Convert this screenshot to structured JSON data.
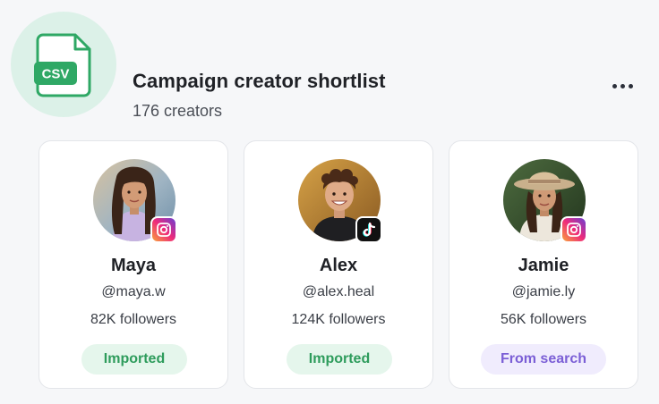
{
  "header": {
    "file_badge": "CSV",
    "title": "Campaign creator shortlist",
    "count": "176 creators",
    "menu_icon": "more-horizontal-icon"
  },
  "colors": {
    "accent_green": "#2fa865",
    "imported_bg": "#e5f6ec",
    "imported_text": "#2e9c5c",
    "search_bg": "#f0ecfd",
    "search_text": "#7b5fd6"
  },
  "creators": [
    {
      "name": "Maya",
      "handle": "@maya.w",
      "followers": "82K followers",
      "platform_icon": "instagram-icon",
      "source": "Imported"
    },
    {
      "name": "Alex",
      "handle": "@alex.heal",
      "followers": "124K followers",
      "platform_icon": "tiktok-icon",
      "source": "Imported"
    },
    {
      "name": "Jamie",
      "handle": "@jamie.ly",
      "followers": "56K followers",
      "platform_icon": "instagram-icon",
      "source": "From search"
    }
  ]
}
